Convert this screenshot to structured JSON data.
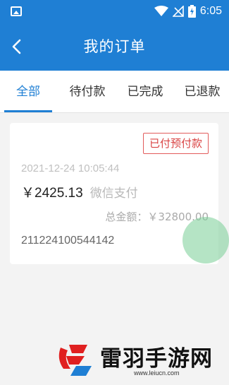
{
  "status_bar": {
    "time": "6:05"
  },
  "header": {
    "title": "我的订单"
  },
  "tabs": [
    {
      "label": "全部",
      "active": true
    },
    {
      "label": "待付款",
      "active": false
    },
    {
      "label": "已完成",
      "active": false
    },
    {
      "label": "已退款",
      "active": false
    }
  ],
  "order": {
    "status": "已付预付款",
    "date": "2021-12-24 10:05:44",
    "paid_amount": "￥2425.13",
    "pay_method": "微信支付",
    "total_label": "总金额：",
    "total_amount": "￥32800.00",
    "order_no": "211224100544142"
  },
  "watermark": {
    "name": "雷羽手游网",
    "url": "www.leiucn.com"
  },
  "colors": {
    "primary": "#1f7fd4",
    "status_red": "#d94343",
    "watermark_red": "#e02020"
  }
}
